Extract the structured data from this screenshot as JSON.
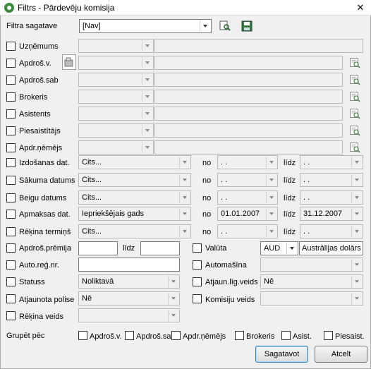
{
  "window": {
    "title": "Filtrs - Pārdevēju komisija",
    "close": "✕"
  },
  "template": {
    "label": "Filtra sagatave",
    "value": "[Nav]"
  },
  "party_rows": [
    {
      "label": "Uzņēmums"
    },
    {
      "label": "Apdroš.v."
    },
    {
      "label": "Apdroš.sab"
    },
    {
      "label": "Brokeris"
    },
    {
      "label": "Asistents"
    },
    {
      "label": "Piesaistītājs"
    },
    {
      "label": "Apdr.ņēmējs"
    }
  ],
  "date_rows": [
    {
      "label": "Izdošanas dat.",
      "period": "Cits...",
      "from": ". .",
      "to": ". ."
    },
    {
      "label": "Sākuma datums",
      "period": "Cits...",
      "from": ". .",
      "to": ". ."
    },
    {
      "label": "Beigu datums",
      "period": "Cits...",
      "from": ". .",
      "to": ". ."
    },
    {
      "label": "Apmaksas dat.",
      "period": "Iepriekšējais gads",
      "from": "01.01.2007",
      "to": "31.12.2007"
    },
    {
      "label": "Rēķina termiņš",
      "period": "Cits...",
      "from": ". .",
      "to": ". ."
    }
  ],
  "date_words": {
    "from": "no",
    "to": "līdz"
  },
  "premium": {
    "label": "Apdroš.prēmija",
    "to": "līdz"
  },
  "currency": {
    "label": "Valūta",
    "code": "AUD",
    "name": "Austrālijas dolārs"
  },
  "auto_reg": {
    "label": "Auto.reģ.nr."
  },
  "automasina": {
    "label": "Automašīna"
  },
  "status": {
    "label": "Statuss",
    "value": "Noliktavā"
  },
  "renew_type": {
    "label": "Atjaun.līg.veids",
    "value": "Nē"
  },
  "renewed": {
    "label": "Atjaunota polise",
    "value": "Nē"
  },
  "commission_type": {
    "label": "Komisiju veids"
  },
  "invoice_type": {
    "label": "Rēķina veids"
  },
  "group": {
    "label": "Grupēt pēc",
    "items": [
      "Apdroš.v.",
      "Apdroš.sab",
      "Apdr.ņēmējs",
      "Brokeris",
      "Asist.",
      "Piesaist."
    ]
  },
  "buttons": {
    "ok": "Sagatavot",
    "cancel": "Atcelt"
  }
}
